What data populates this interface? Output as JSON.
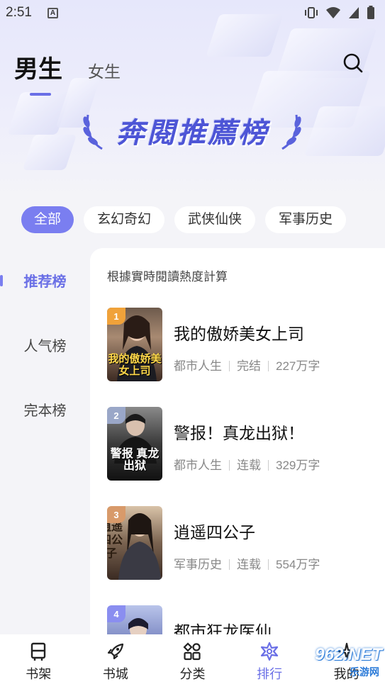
{
  "status_bar": {
    "time": "2:51",
    "notification_icon": "a-icon",
    "icons": [
      "vibrate-icon",
      "wifi-icon",
      "signal-icon",
      "battery-icon"
    ]
  },
  "header": {
    "tabs": [
      {
        "label": "男生",
        "active": true
      },
      {
        "label": "女生",
        "active": false
      }
    ],
    "banner_title": "奔閱推薦榜",
    "search_icon": "search-icon"
  },
  "categories": [
    {
      "label": "全部",
      "active": true
    },
    {
      "label": "玄幻奇幻",
      "active": false
    },
    {
      "label": "武侠仙侠",
      "active": false
    },
    {
      "label": "军事历史",
      "active": false
    }
  ],
  "side_menu": [
    {
      "label": "推荐榜",
      "active": true
    },
    {
      "label": "人气榜",
      "active": false
    },
    {
      "label": "完本榜",
      "active": false
    }
  ],
  "ranking": {
    "note": "根據實時閱讀熱度計算",
    "books": [
      {
        "rank": "1",
        "title": "我的傲娇美女上司",
        "genre": "都市人生",
        "status": "完结",
        "words": "227万字",
        "cover_text": "我的傲娇美女上司"
      },
      {
        "rank": "2",
        "title": "警报！真龙出狱！",
        "genre": "都市人生",
        "status": "连载",
        "words": "329万字",
        "cover_text": "警报 真龙出狱"
      },
      {
        "rank": "3",
        "title": "逍遥四公子",
        "genre": "军事历史",
        "status": "连载",
        "words": "554万字",
        "cover_text": "逍遥四公子"
      },
      {
        "rank": "4",
        "title": "都市狂龙医仙",
        "genre": "",
        "status": "",
        "words": "",
        "cover_text": ""
      }
    ]
  },
  "bottom_nav": [
    {
      "label": "书架",
      "icon": "bookshelf-icon",
      "active": false
    },
    {
      "label": "书城",
      "icon": "rocket-icon",
      "active": false
    },
    {
      "label": "分类",
      "icon": "category-icon",
      "active": false
    },
    {
      "label": "排行",
      "icon": "ranking-star-icon",
      "active": true
    },
    {
      "label": "我的",
      "icon": "profile-icon",
      "active": false
    }
  ],
  "watermark": {
    "text": "962.NET",
    "sub": "乐游网"
  },
  "colors": {
    "accent": "#6a6fe6",
    "chip_active": "#7a7ef0",
    "banner": "#4d55d6"
  }
}
